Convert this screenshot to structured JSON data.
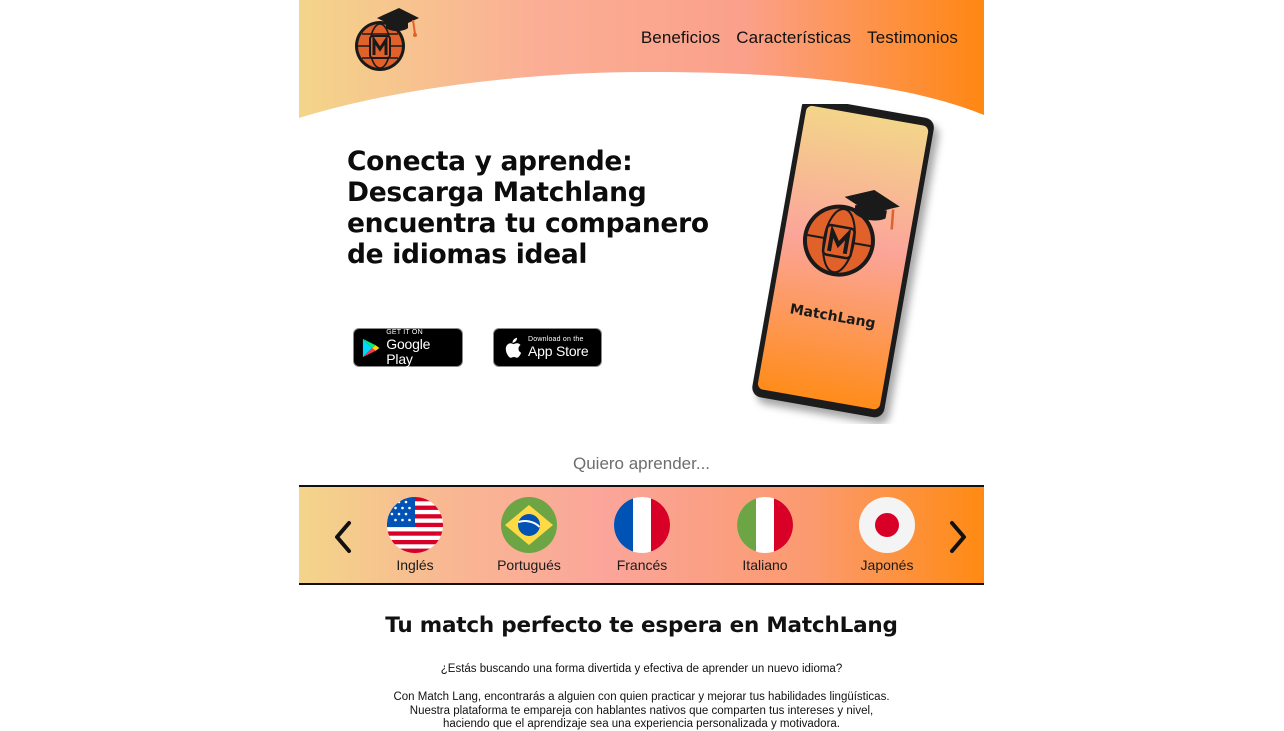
{
  "nav": {
    "items": [
      "Beneficios",
      "Características",
      "Testimonios"
    ]
  },
  "hero": {
    "title_lines": [
      "Conecta y aprende:",
      "Descarga Matchlang",
      "encuentra tu companero",
      "de idiomas ideal"
    ],
    "google_play": {
      "small": "GET IT ON",
      "big": "Google Play"
    },
    "app_store": {
      "small": "Download on the",
      "big": "App Store"
    },
    "phone_app_name": "MatchLang"
  },
  "languages": {
    "heading": "Quiero aprender...",
    "items": [
      {
        "name": "Inglés",
        "flag": "usa-flag-icon"
      },
      {
        "name": "Portugués",
        "flag": "brazil-flag-icon"
      },
      {
        "name": "Francés",
        "flag": "france-flag-icon"
      },
      {
        "name": "Italiano",
        "flag": "italy-flag-icon"
      },
      {
        "name": "Japonés",
        "flag": "japan-flag-icon"
      }
    ]
  },
  "about": {
    "title": "Tu match perfecto te espera en MatchLang",
    "p1": "¿Estás buscando una forma divertida y efectiva de aprender un nuevo idioma?",
    "p2_lines": [
      "Con Match Lang, encontrarás a alguien con quien practicar y mejorar tus habilidades lingüísticas.",
      "Nuestra plataforma te empareja con hablantes nativos que comparten tus intereses y nivel,",
      "haciendo que el aprendizaje sea una experiencia personalizada y motivadora."
    ]
  },
  "colors": {
    "gradient_start": "#f3d58a",
    "gradient_mid": "#fba59a",
    "gradient_end": "#ff8a12",
    "logo_globe": "#e0612a"
  }
}
